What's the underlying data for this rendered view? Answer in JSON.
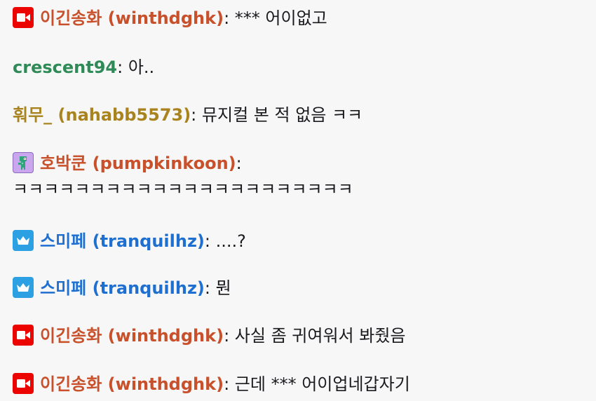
{
  "colors": {
    "red_user": "#c8502a",
    "green_user": "#2e8b57",
    "gold_user": "#a8831e",
    "blue_user": "#1e6fcf",
    "broadcaster_badge": "#eb0400",
    "vip_badge": "#2ba0e3"
  },
  "messages": [
    {
      "badge": "video-camera-icon",
      "user": "이긴송화 (winthdghk)",
      "sep": ":",
      "text": "*** 어이없고"
    },
    {
      "badge": "",
      "user": "crescent94",
      "sep": ":",
      "text": "아.."
    },
    {
      "badge": "",
      "user": "훠무_ (nahabb5573)",
      "sep": ":",
      "text": "뮤지컬 본 적 없음 ㅋㅋ"
    },
    {
      "badge": "pixel-dino-icon",
      "user": "호박쿤 (pumpkinkoon)",
      "sep": ":",
      "text": "ㅋㅋㅋㅋㅋㅋㅋㅋㅋㅋㅋㅋㅋㅋㅋㅋㅋㅋㅋㅋㅋㅋ"
    },
    {
      "badge": "crown-icon",
      "user": "스미페 (tranquilhz)",
      "sep": ":",
      "text": "....?"
    },
    {
      "badge": "crown-icon",
      "user": "스미페 (tranquilhz)",
      "sep": ":",
      "text": "뭔"
    },
    {
      "badge": "video-camera-icon",
      "user": "이긴송화 (winthdghk)",
      "sep": ":",
      "text": "사실 좀 귀여워서 봐줬음"
    },
    {
      "badge": "video-camera-icon",
      "user": "이긴송화 (winthdghk)",
      "sep": ":",
      "text": "근데 *** 어이업네갑자기"
    }
  ]
}
